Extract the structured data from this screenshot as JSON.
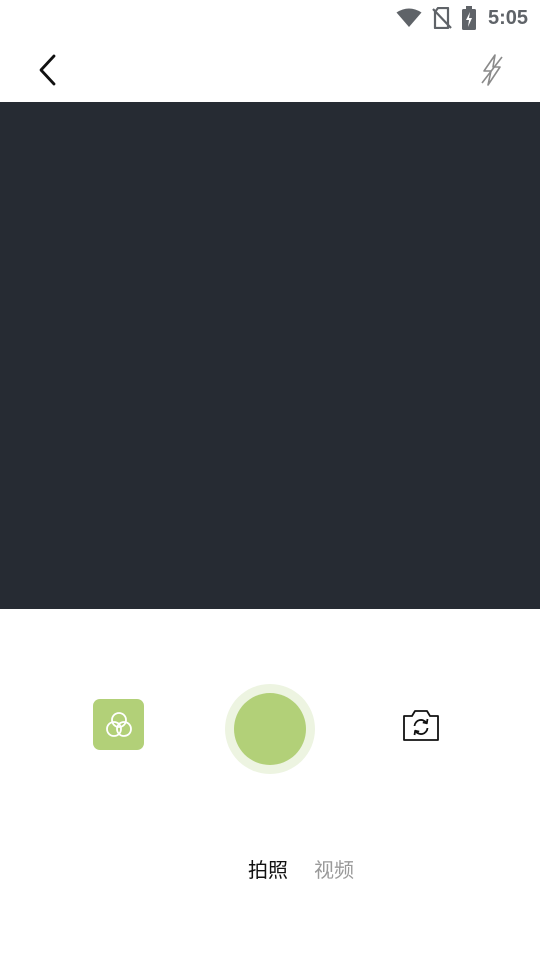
{
  "status_bar": {
    "time": "5:05",
    "icons": [
      "wifi-icon",
      "no-sim-icon",
      "battery-charging-icon"
    ]
  },
  "top_bar": {
    "back_icon": "chevron-left-icon",
    "flash_icon": "flash-off-icon"
  },
  "controls": {
    "filter_icon": "filter-circles-icon",
    "shutter_icon": "shutter-icon",
    "switch_icon": "switch-camera-icon"
  },
  "mode_tabs": [
    {
      "label": "拍照",
      "active": true
    },
    {
      "label": "视频",
      "active": false
    }
  ],
  "colors": {
    "accent": "#b2d078",
    "shutter_ring": "#edf4e1",
    "preview_bg": "#262b33",
    "active_tab": "#111111",
    "inactive_tab": "#9a9a9a"
  }
}
